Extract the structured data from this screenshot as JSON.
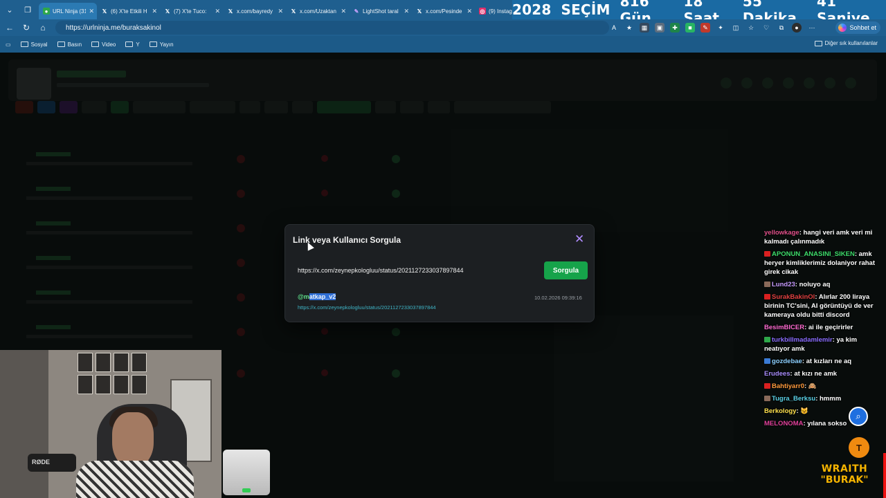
{
  "browser": {
    "tabs": [
      {
        "label": "URL Ninja (31)",
        "favicon": "page-icon",
        "active": true
      },
      {
        "label": "(6) X'te Etkili H",
        "favicon": "x-icon"
      },
      {
        "label": "(7) X'te Tuco:",
        "favicon": "x-icon"
      },
      {
        "label": "x.com/bayredy",
        "favicon": "x-icon"
      },
      {
        "label": "x.com/Uzaktan",
        "favicon": "x-icon"
      },
      {
        "label": "LightShot taral",
        "favicon": "feather-icon"
      },
      {
        "label": "x.com/Pesinde",
        "favicon": "x-icon"
      },
      {
        "label": "(9) Instag",
        "favicon": "instagram-icon"
      }
    ],
    "url": "https://urlninja.me/buraksakinol",
    "copilot_label": "Sohbet et",
    "bookmarks": [
      "Sosyal",
      "Basın",
      "Video",
      "Y",
      "Yayın"
    ],
    "other_bookmarks": "Diğer sık kullanılanlar"
  },
  "countdown": {
    "year": "2028",
    "label": "SEÇİM",
    "days": "816 Gün",
    "hours": "18 Saat",
    "minutes": "55 Dakika",
    "seconds": "41 Saniye"
  },
  "modal": {
    "title": "Link veya Kullanıcı Sorgula",
    "query_value": "https://x.com/zeynepkologluu/status/2021127233037897844",
    "submit_label": "Sorgula",
    "result": {
      "user_prefix": "@m",
      "user_selected": "atkap_v2",
      "link": "https://x.com/zeynepkologluu/status/2021127233037897844",
      "timestamp": "10.02.2026 09:39:16"
    }
  },
  "chat": [
    {
      "user": "yellowkage",
      "color": "#e0508a",
      "text": "hangi veri amk veri mi kalmadı çalınmadık"
    },
    {
      "user": "APONUN_ANASINI_SIKEN",
      "color": "#3ddc6a",
      "text": "amk heryer kimliklerimiz dolaniyor rahat girek cikak",
      "badge": "#d92020"
    },
    {
      "user": "Lund23",
      "color": "#c79bff",
      "text": "noluyo aq",
      "badge": "#8a6a5a"
    },
    {
      "user": "SurakBakinOl",
      "color": "#e04040",
      "text": "Alırlar 200 liraya birinin TC'sini, AI görüntüyü de ver kameraya oldu bitti discord",
      "badge": "#d92020"
    },
    {
      "user": "BesimBICER",
      "color": "#ff6ad0",
      "text": "ai ile geçirirler"
    },
    {
      "user": "turkbillmadamlemir",
      "color": "#8a6cff",
      "text": "ya kim neatıyor amk",
      "badge": "#2ea84a"
    },
    {
      "user": "gozdebae",
      "color": "#8cd0ff",
      "text": "at kızları ne aq",
      "badge": "#3a7bd5"
    },
    {
      "user": "Erudees",
      "color": "#a78bfa",
      "text": "at kızı ne amk"
    },
    {
      "user": "Bahtiyarr0",
      "color": "#ff9a3c",
      "text": "🙈",
      "badge": "#d92020"
    },
    {
      "user": "Tugra_Berksu",
      "color": "#5ad1e6",
      "text": "hmmm",
      "badge": "#8a6a5a"
    },
    {
      "user": "Berkology",
      "color": "#ffe14d",
      "text": "😺"
    },
    {
      "user": "MELONOMA",
      "color": "#e0409a",
      "text": "yılana sokso"
    }
  ],
  "webcam": {
    "mic_brand": "RØDE"
  },
  "logo": {
    "line1": "WRAITH",
    "line2": "\"BURAK\""
  },
  "colors": {
    "accent_green": "#16a34a",
    "close_purple": "#b18cff",
    "browser_blue": "#1f5f8f"
  }
}
